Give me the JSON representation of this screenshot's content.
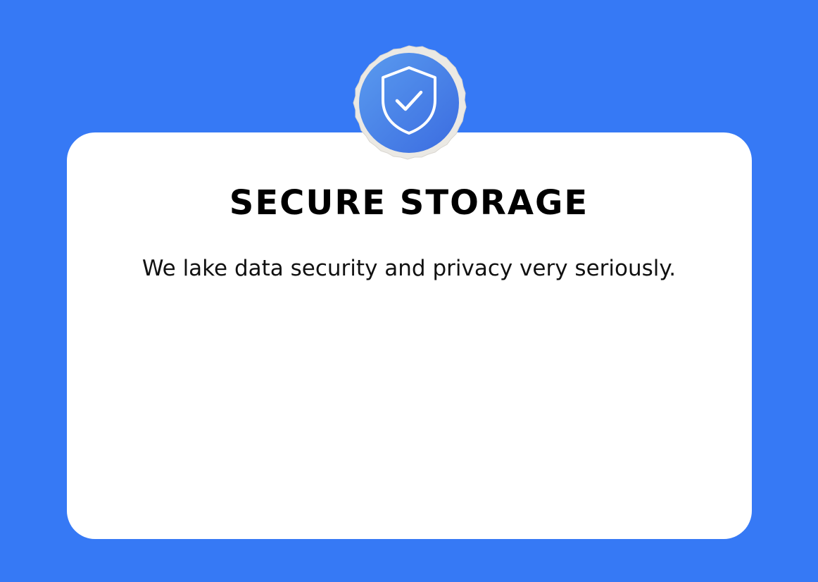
{
  "colors": {
    "background": "#3679f5",
    "card": "#ffffff",
    "badge_gradient_start": "#5a97ee",
    "badge_gradient_end": "#3f6fe0",
    "badge_border": "#eceae6"
  },
  "badge": {
    "icon": "shield-check-icon"
  },
  "card": {
    "title": "SECURE STORAGE",
    "subtitle": "We lake data security and privacy very seriously."
  }
}
